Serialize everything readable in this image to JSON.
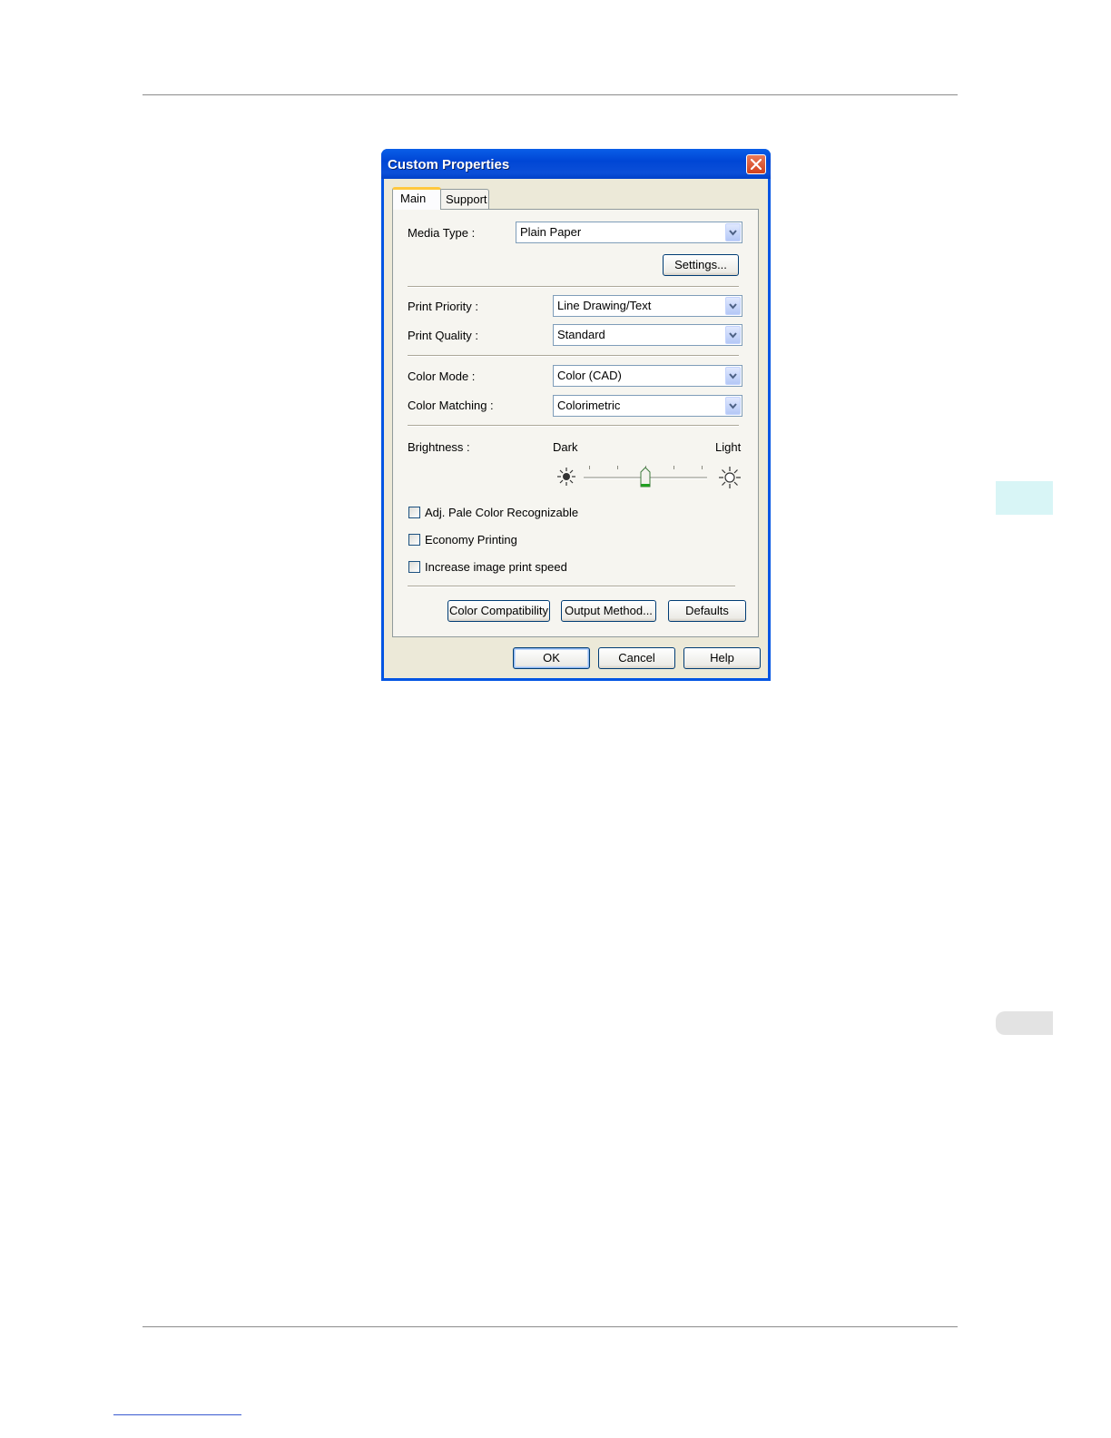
{
  "dialog": {
    "title": "Custom Properties",
    "tabs": [
      {
        "label": "Main"
      },
      {
        "label": "Support"
      }
    ],
    "media_type": {
      "label": "Media Type :",
      "value": "Plain Paper"
    },
    "settings_button": "Settings...",
    "print_priority": {
      "label": "Print Priority :",
      "value": "Line Drawing/Text"
    },
    "print_quality": {
      "label": "Print Quality :",
      "value": "Standard"
    },
    "color_mode": {
      "label": "Color Mode :",
      "value": "Color (CAD)"
    },
    "color_matching": {
      "label": "Color Matching :",
      "value": "Colorimetric"
    },
    "brightness": {
      "label": "Brightness :",
      "min_label": "Dark",
      "max_label": "Light",
      "ticks": 5,
      "level": 3
    },
    "checkboxes": [
      {
        "label": "Adj. Pale Color Recognizable",
        "checked": false
      },
      {
        "label": "Economy Printing",
        "checked": false
      },
      {
        "label": "Increase image print speed",
        "checked": false
      }
    ],
    "panel_buttons": {
      "color_compatibility": "Color Compatibility",
      "output_method": "Output Method...",
      "defaults": "Defaults"
    },
    "footer_buttons": {
      "ok": "OK",
      "cancel": "Cancel",
      "help": "Help"
    }
  }
}
